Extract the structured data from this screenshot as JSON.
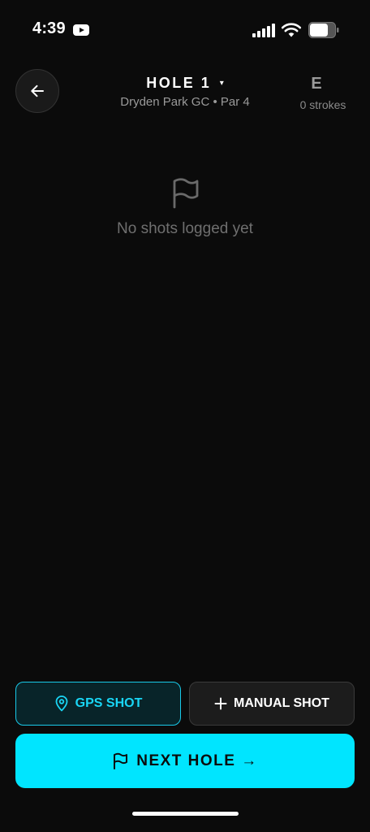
{
  "status_bar": {
    "time": "4:39"
  },
  "header": {
    "hole_title": "HOLE 1",
    "caret": "▾",
    "course_info": "Dryden Park GC • Par 4",
    "score": "E",
    "strokes": "0 strokes"
  },
  "empty_state": {
    "message": "No shots logged yet"
  },
  "actions": {
    "gps_label": "GPS SHOT",
    "manual_label": "MANUAL SHOT",
    "next_label": "NEXT HOLE →"
  },
  "colors": {
    "background": "#0b0b0b",
    "accent": "#00e5ff",
    "muted_text": "#9a9a9a"
  },
  "icons": [
    "youtube-icon",
    "signal-icon",
    "wifi-icon",
    "battery-icon",
    "back-arrow-icon",
    "flag-icon",
    "location-pin-icon",
    "plus-icon"
  ]
}
